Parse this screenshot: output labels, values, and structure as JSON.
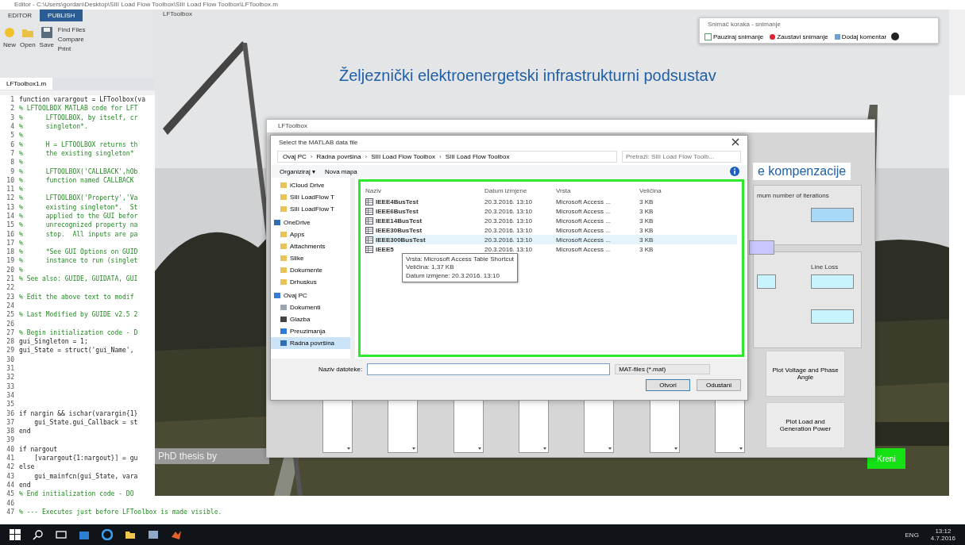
{
  "matlab": {
    "title": "Editor - C:\\Users\\gordan\\Desktop\\SIII Load Flow Toolbox\\SIII Load Flow Toolbox\\LFToolbox.m",
    "tabs": [
      {
        "label": "EDITOR",
        "selected": true
      },
      {
        "label": "PUBLISH",
        "selected": false
      }
    ],
    "tools": [
      "New",
      "Open",
      "Save"
    ],
    "small_tools": [
      "Find Files",
      "Compare",
      "Print"
    ],
    "file_tab": "LFToolbox1.m",
    "code": [
      {
        "n": "1",
        "text": "function varargout = LFToolbox(va"
      },
      {
        "n": "2",
        "text": "% LFTOOLBOX MATLAB code for LFT"
      },
      {
        "n": "3",
        "text": "%      LFTOOLBOX, by itself, cr"
      },
      {
        "n": "4",
        "text": "%      singleton*."
      },
      {
        "n": "5",
        "text": "%"
      },
      {
        "n": "6",
        "text": "%      H = LFTOOLBOX returns th"
      },
      {
        "n": "7",
        "text": "%      the existing singleton*"
      },
      {
        "n": "8",
        "text": "%"
      },
      {
        "n": "9",
        "text": "%      LFTOOLBOX('CALLBACK',hOb"
      },
      {
        "n": "10",
        "text": "%      function named CALLBACK"
      },
      {
        "n": "11",
        "text": "%"
      },
      {
        "n": "12",
        "text": "%      LFTOOLBOX('Property','Va"
      },
      {
        "n": "13",
        "text": "%      existing singleton*.  St"
      },
      {
        "n": "14",
        "text": "%      applied to the GUI befor"
      },
      {
        "n": "15",
        "text": "%      unrecognized property na"
      },
      {
        "n": "16",
        "text": "%      stop.  All inputs are pa"
      },
      {
        "n": "17",
        "text": "%"
      },
      {
        "n": "18",
        "text": "%      *See GUI Options on GUID"
      },
      {
        "n": "19",
        "text": "%      instance to run (singlet"
      },
      {
        "n": "20",
        "text": "%"
      },
      {
        "n": "21",
        "text": "% See also: GUIDE, GUIDATA, GUI"
      },
      {
        "n": "22"
      },
      {
        "n": "23",
        "text": "% Edit the above text to modif"
      },
      {
        "n": "24"
      },
      {
        "n": "25",
        "text": "% Last Modified by GUIDE v2.5 2"
      },
      {
        "n": "26"
      },
      {
        "n": "27",
        "text": "% Begin initialization code - D"
      },
      {
        "n": "28",
        "text": "gui_Singleton = 1;"
      },
      {
        "n": "29",
        "text": "gui_State = struct('gui_Name',"
      },
      {
        "n": "30"
      },
      {
        "n": "31"
      },
      {
        "n": "32"
      },
      {
        "n": "33"
      },
      {
        "n": "34"
      },
      {
        "n": "35"
      },
      {
        "n": "36",
        "text": "if nargin && ischar(varargin{1}"
      },
      {
        "n": "37",
        "text": "    gui_State.gui_Callback = st"
      },
      {
        "n": "38",
        "text": "end"
      },
      {
        "n": "39"
      },
      {
        "n": "40",
        "text": "if nargout"
      },
      {
        "n": "41",
        "text": "    [varargout{1:nargout}] = gu"
      },
      {
        "n": "42",
        "text": "else"
      },
      {
        "n": "43",
        "text": "    gui_mainfcn(gui_State, vara"
      },
      {
        "n": "44",
        "text": "end"
      },
      {
        "n": "45",
        "text": "% End initialization code - DO"
      },
      {
        "n": "46"
      },
      {
        "n": "47",
        "text": "% --- Executes just before LFToolbox is made visible."
      }
    ]
  },
  "figure": {
    "title": "LFToolbox",
    "heading": "Željeznički elektroenergetski infrastrukturni podsustav",
    "credit": "PhD thesis by",
    "start_button": "Kreni"
  },
  "gui": {
    "title": "LFToolbox",
    "heading": "e kompenzacije",
    "iterations_label": "mum number of iterations",
    "line_loss_label": "Line Loss",
    "plot_buttons": [
      "Plot Voltage and Phase Angle",
      "Plot Load and Generation Power"
    ]
  },
  "dialog": {
    "title": "Select the MATLAB data file",
    "path": [
      "Ovaj PC",
      "Radna površina",
      "SIII Load Flow Toolbox",
      "SIII Load Flow Toolbox"
    ],
    "path_separator": "›",
    "search": {
      "placeholder": "Pretraži: SIII Load Flow Toolb..."
    },
    "toolbar": [
      "Organiziraj ▾",
      "Nova mapa"
    ],
    "nav": [
      {
        "label": "iCloud Drive",
        "kind": "folder",
        "selected": false
      },
      {
        "label": "SIII LoadFlow T",
        "kind": "folder",
        "selected": false
      },
      {
        "label": "SIII LoadFlow T",
        "kind": "folder",
        "selected": false
      },
      {
        "label": "OneDrive",
        "kind": "cloud",
        "selected": false
      },
      {
        "label": "Apps",
        "kind": "folder",
        "selected": false
      },
      {
        "label": "Attachments",
        "kind": "folder",
        "selected": false
      },
      {
        "label": "Slike",
        "kind": "folder",
        "selected": false
      },
      {
        "label": "Dokumente",
        "kind": "folder",
        "selected": false
      },
      {
        "label": "Drhuskus",
        "kind": "folder",
        "selected": false
      },
      {
        "label": "Ovaj PC",
        "kind": "pc",
        "selected": false
      },
      {
        "label": "Dokumenti",
        "kind": "doc",
        "selected": false
      },
      {
        "label": "Glazba",
        "kind": "music",
        "selected": false
      },
      {
        "label": "Preuzimanja",
        "kind": "download",
        "selected": false
      },
      {
        "label": "Radna površina",
        "kind": "desktop",
        "selected": true
      }
    ],
    "columns": [
      "Naziv",
      "Datum izmjene",
      "Vrsta",
      "Veličina"
    ],
    "files": [
      {
        "name": "IEEE4BusTest",
        "date": "20.3.2016. 13:10",
        "type": "Microsoft Access ...",
        "size": "3 KB",
        "selected": false
      },
      {
        "name": "IEEE6BusTest",
        "date": "20.3.2016. 13:10",
        "type": "Microsoft Access ...",
        "size": "3 KB",
        "selected": false
      },
      {
        "name": "IEEE14BusTest",
        "date": "20.3.2016. 13:10",
        "type": "Microsoft Access ...",
        "size": "3 KB",
        "selected": false
      },
      {
        "name": "IEEE30BusTest",
        "date": "20.3.2016. 13:10",
        "type": "Microsoft Access ...",
        "size": "3 KB",
        "selected": false
      },
      {
        "name": "IEEE300BusTest",
        "date": "20.3.2016. 13:10",
        "type": "Microsoft Access ...",
        "size": "3 KB",
        "selected": true
      },
      {
        "name": "IEEE5",
        "date": "20.3.2016. 13:10",
        "type": "Microsoft Access ...",
        "size": "3 KB",
        "selected": false
      }
    ],
    "tooltip": [
      "Vrsta: Microsoft Access Table Shortcut",
      "Veličina: 1,37 KB",
      "Datum izmjene: 20.3.2016. 13:10"
    ],
    "filename_label": "Naziv datoteke:",
    "filetype": "MAT-files (*.mat)",
    "buttons": [
      "Otvori",
      "Odustani"
    ]
  },
  "recorder": {
    "title": "Snimač koraka - snimanje",
    "buttons": [
      "Pauziraj snimanje",
      "Zaustavi snimanje",
      "Dodaj komentar"
    ]
  },
  "taskbar": {
    "lang": "ENG",
    "time": "13:12",
    "date": "4.7.2016"
  }
}
